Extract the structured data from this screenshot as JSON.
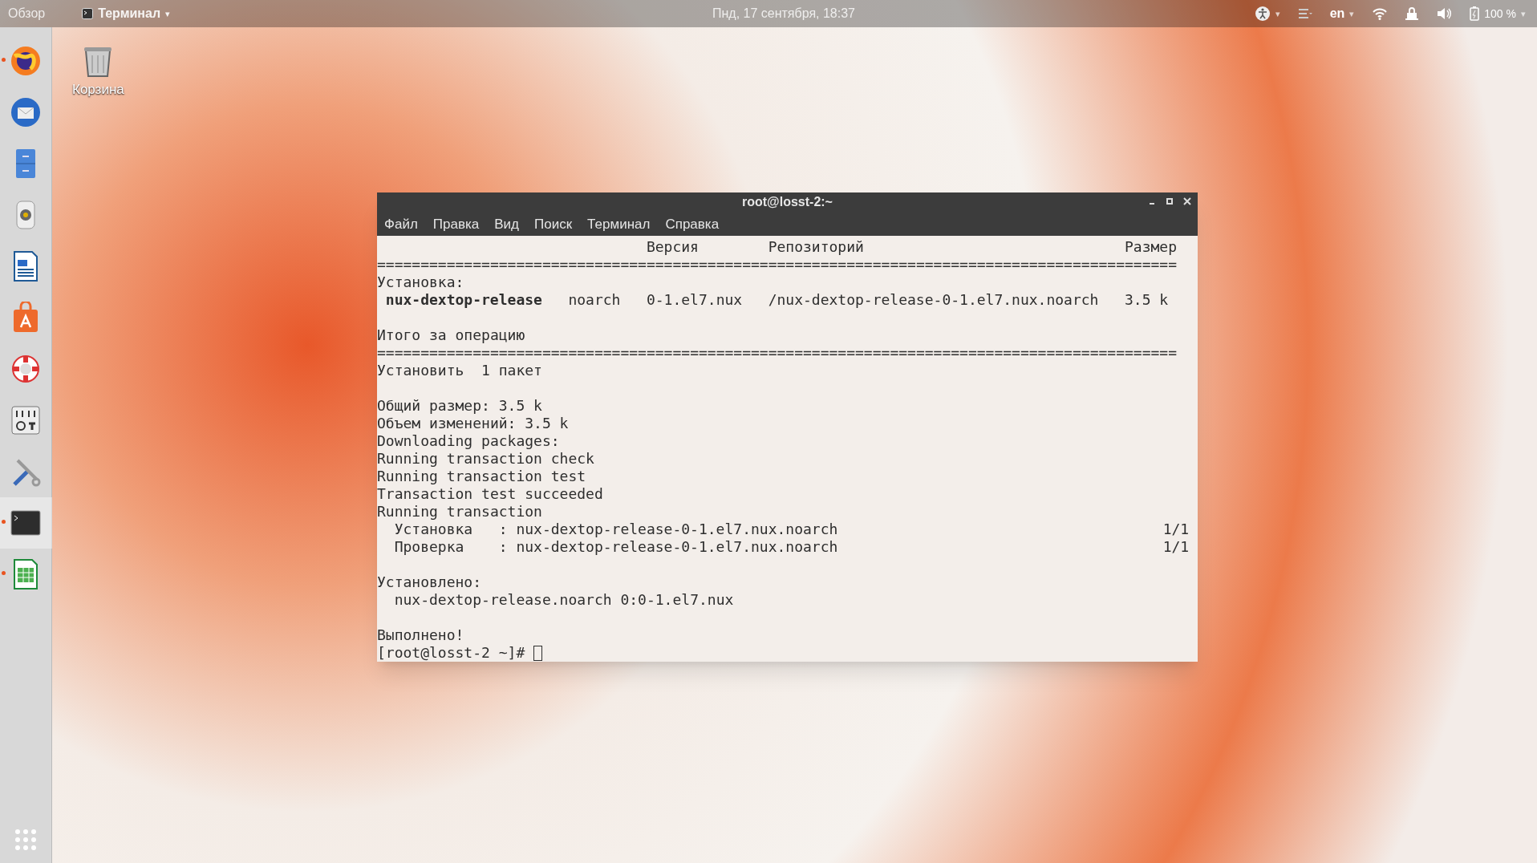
{
  "top_bar": {
    "activities": "Обзор",
    "app_menu": {
      "label": "Терминал",
      "caret": "▾"
    },
    "clock": "Пнд, 17 сентября, 18:37",
    "indicators": [
      {
        "kind": "accessibility",
        "caret": "▾"
      },
      {
        "kind": "menu"
      },
      {
        "kind": "keyboard",
        "label": "en",
        "caret": "▾"
      },
      {
        "kind": "wifi"
      },
      {
        "kind": "lock"
      },
      {
        "kind": "volume"
      },
      {
        "kind": "battery",
        "label": "100 %",
        "caret": "▾"
      }
    ]
  },
  "dock": {
    "items": [
      {
        "kind": "browser",
        "running": true,
        "selected": false
      },
      {
        "kind": "mail",
        "running": false,
        "selected": false
      },
      {
        "kind": "files",
        "running": false,
        "selected": false
      },
      {
        "kind": "speaker",
        "running": false,
        "selected": false
      },
      {
        "kind": "document",
        "running": false,
        "selected": false
      },
      {
        "kind": "store",
        "running": false,
        "selected": false
      },
      {
        "kind": "help",
        "running": false,
        "selected": false
      },
      {
        "kind": "mixer",
        "running": false,
        "selected": false
      },
      {
        "kind": "tools",
        "running": false,
        "selected": false
      },
      {
        "kind": "terminal",
        "running": true,
        "selected": true
      },
      {
        "kind": "spreadsheet",
        "running": true,
        "selected": false
      }
    ]
  },
  "desktop_icons": [
    {
      "kind": "trash",
      "label": "Корзина"
    }
  ],
  "terminal": {
    "title": "root@losst-2:~",
    "menu": [
      "Файл",
      "Правка",
      "Вид",
      "Поиск",
      "Терминал",
      "Справка"
    ],
    "lines": [
      {
        "kind": "table_header",
        "cells": [
          "",
          "",
          "Версия",
          "Репозиторий",
          "Размер"
        ]
      },
      {
        "kind": "rule",
        "text": "============================================================================================"
      },
      {
        "kind": "text",
        "text": "Установка:"
      },
      {
        "kind": "table_row",
        "cells": [
          "nux-dextop-release",
          "noarch",
          "0-1.el7.nux",
          "/nux-dextop-release-0-1.el7.nux.noarch",
          "3.5 k"
        ]
      },
      {
        "kind": "blank"
      },
      {
        "kind": "text",
        "text": "Итого за операцию"
      },
      {
        "kind": "rule",
        "text": "============================================================================================"
      },
      {
        "kind": "text",
        "text": "Установить  1 пакет"
      },
      {
        "kind": "blank"
      },
      {
        "kind": "text",
        "text": "Общий размер: 3.5 k"
      },
      {
        "kind": "text",
        "text": "Объем изменений: 3.5 k"
      },
      {
        "kind": "text",
        "text": "Downloading packages:"
      },
      {
        "kind": "text",
        "text": "Running transaction check"
      },
      {
        "kind": "text",
        "text": "Running transaction test"
      },
      {
        "kind": "text",
        "text": "Transaction test succeeded"
      },
      {
        "kind": "text",
        "text": "Running transaction"
      },
      {
        "kind": "step",
        "label": "Установка",
        "sep": ":",
        "path": "nux-dextop-release-0-1.el7.nux.noarch",
        "count": "1/1"
      },
      {
        "kind": "step",
        "label": "Проверка",
        "sep": ":",
        "path": "nux-dextop-release-0-1.el7.nux.noarch",
        "count": "1/1"
      },
      {
        "kind": "blank"
      },
      {
        "kind": "text",
        "text": "Установлено:"
      },
      {
        "kind": "indented",
        "text": "nux-dextop-release.noarch 0:0-1.el7.nux"
      },
      {
        "kind": "blank"
      },
      {
        "kind": "text",
        "text": "Выполнено!"
      },
      {
        "kind": "prompt",
        "text": "[root@losst-2 ~]#",
        "cursor": true
      }
    ]
  }
}
